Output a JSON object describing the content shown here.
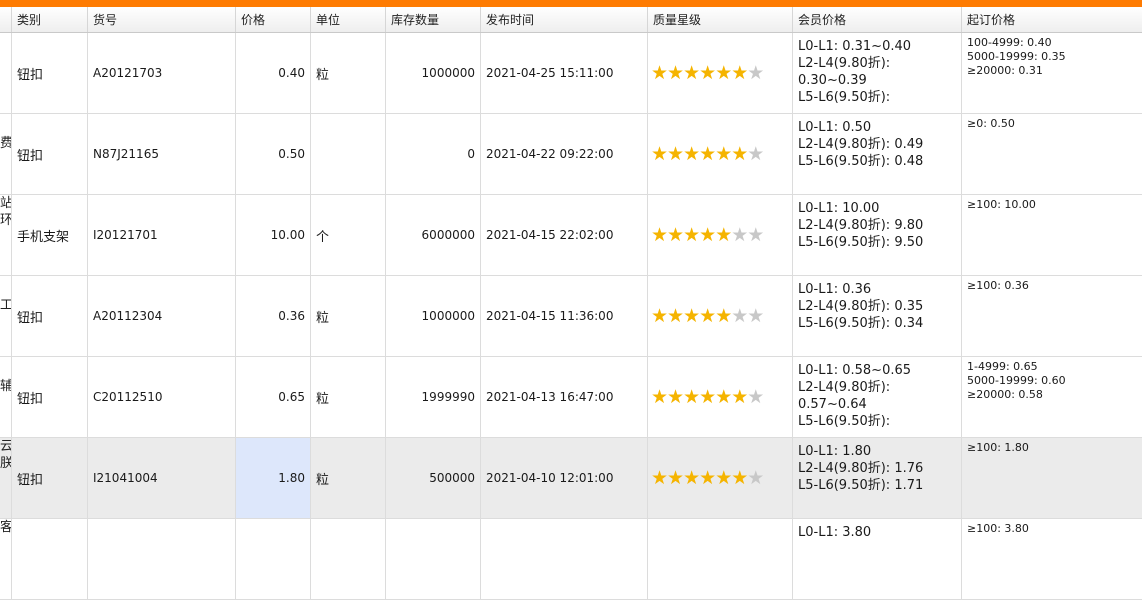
{
  "headers": {
    "category": "类别",
    "item_no": "货号",
    "price": "价格",
    "unit": "单位",
    "stock": "库存数量",
    "publish_time": "发布时间",
    "quality": "质量星级",
    "member_price": "会员价格",
    "moq_price": "起订价格"
  },
  "colors": {
    "top_bar": "#fe7b02",
    "star_on": "#f5b400",
    "star_off": "#c8c8c8",
    "selected_cell": "#dde7fb"
  },
  "rows": [
    {
      "left_fragment": "",
      "category": "钮扣",
      "item_no": "A20121703",
      "price": "0.40",
      "unit": "粒",
      "stock": "1000000",
      "publish_time": "2021-04-25 15:11:00",
      "stars": 6,
      "member": [
        "L0-L1: 0.31~0.40",
        "L2-L4(9.80折):",
        "0.30~0.39",
        "L5-L6(9.50折):"
      ],
      "moq": [
        "100-4999: 0.40",
        "5000-19999: 0.35",
        "≥20000: 0.31"
      ]
    },
    {
      "left_fragment": "费",
      "category": "钮扣",
      "item_no": "N87J21165",
      "price": "0.50",
      "unit": "",
      "stock": "0",
      "publish_time": "2021-04-22 09:22:00",
      "stars": 6,
      "member": [
        "L0-L1: 0.50",
        "L2-L4(9.80折): 0.49",
        "L5-L6(9.50折): 0.48"
      ],
      "moq": [
        "≥0: 0.50"
      ]
    },
    {
      "left_fragment": "站\n环",
      "category": "手机支架",
      "item_no": "I20121701",
      "price": "10.00",
      "unit": "个",
      "stock": "6000000",
      "publish_time": "2021-04-15 22:02:00",
      "stars": 5,
      "member": [
        "L0-L1: 10.00",
        "L2-L4(9.80折): 9.80",
        "L5-L6(9.50折): 9.50"
      ],
      "moq": [
        "≥100: 10.00"
      ]
    },
    {
      "left_fragment": "工",
      "category": "钮扣",
      "item_no": "A20112304",
      "price": "0.36",
      "unit": "粒",
      "stock": "1000000",
      "publish_time": "2021-04-15 11:36:00",
      "stars": 5,
      "member": [
        "L0-L1: 0.36",
        "L2-L4(9.80折): 0.35",
        "L5-L6(9.50折): 0.34"
      ],
      "moq": [
        "≥100: 0.36"
      ]
    },
    {
      "left_fragment": "辅",
      "category": "钮扣",
      "item_no": "C20112510",
      "price": "0.65",
      "unit": "粒",
      "stock": "1999990",
      "publish_time": "2021-04-13 16:47:00",
      "stars": 6,
      "member": [
        "L0-L1: 0.58~0.65",
        "L2-L4(9.80折):",
        "0.57~0.64",
        "L5-L6(9.50折):"
      ],
      "moq": [
        "1-4999: 0.65",
        "5000-19999: 0.60",
        "≥20000: 0.58"
      ]
    },
    {
      "left_fragment": "云\n朕",
      "category": "钮扣",
      "item_no": "I21041004",
      "price": "1.80",
      "unit": "粒",
      "stock": "500000",
      "publish_time": "2021-04-10 12:01:00",
      "stars": 6,
      "member": [
        "L0-L1: 1.80",
        "L2-L4(9.80折): 1.76",
        "L5-L6(9.50折): 1.71"
      ],
      "moq": [
        "≥100: 1.80"
      ]
    },
    {
      "left_fragment": "客",
      "category": "",
      "item_no": "",
      "price": "",
      "unit": "",
      "stock": "",
      "publish_time": "",
      "stars": 0,
      "member": [
        "L0-L1: 3.80"
      ],
      "moq": [
        "≥100: 3.80"
      ]
    }
  ],
  "selected_row": 5,
  "star_total": 7
}
